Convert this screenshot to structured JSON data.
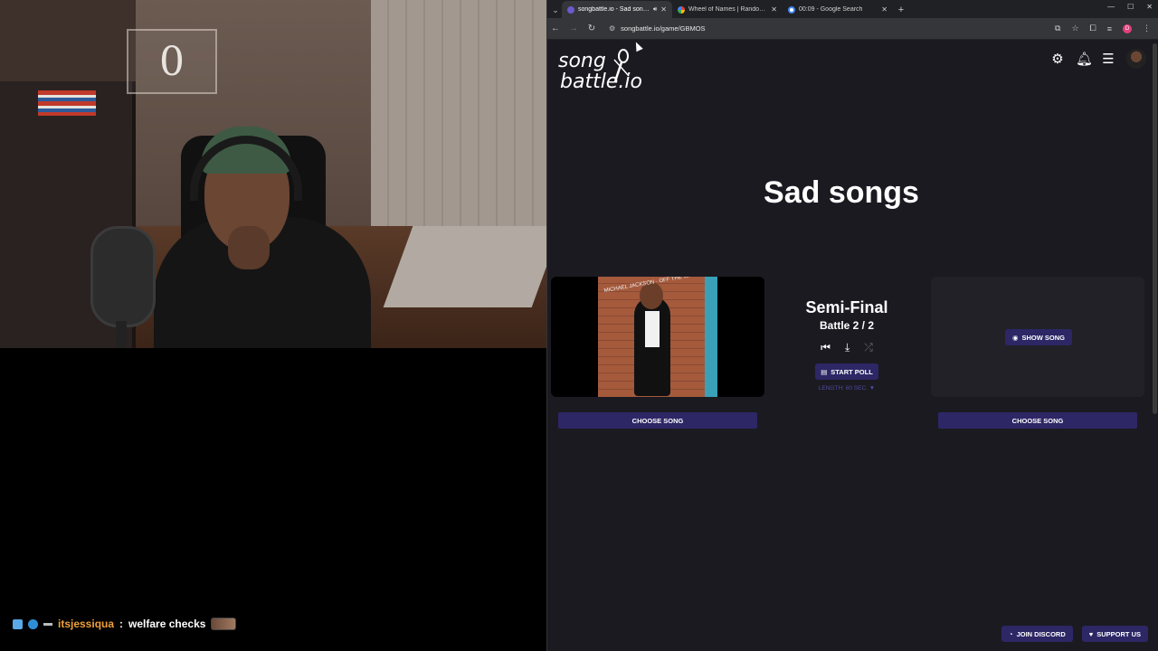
{
  "chat": {
    "username": "itsjessiqua",
    "separator": ":",
    "message": "welfare checks"
  },
  "browser": {
    "tabs": [
      {
        "title": "songbattle.io - Sad songs",
        "active": true
      },
      {
        "title": "Wheel of Names | Random na",
        "active": false
      },
      {
        "title": "00:09 - Google Search",
        "active": false
      }
    ],
    "url": "songbattle.io/game/GBMOS",
    "profile_initial": "D"
  },
  "page": {
    "logo_line1": "song",
    "logo_line2": "battle.io",
    "title": "Sad songs",
    "round_name": "Semi-Final",
    "battle_label": "Battle 2 / 2",
    "start_poll_label": "START POLL",
    "length_label": "LENGTH: 60 SEC. ▼",
    "show_song_label": "SHOW SONG",
    "choose_song_left": "CHOOSE SONG",
    "choose_song_right": "CHOOSE SONG",
    "album_text": "MICHAEL JACKSON · OFF THE WALL",
    "footer": {
      "discord_label": "JOIN DISCORD",
      "support_label": "SUPPORT US"
    }
  },
  "icons": {
    "settings": "gear-icon",
    "notifications": "bell-icon",
    "menu": "hamburger-icon",
    "eye": "eye-icon",
    "discord": "discord-icon",
    "support": "heart-icon"
  },
  "colors": {
    "page_bg": "#1b1a21",
    "button_bg": "#2d2766",
    "length_text": "#4e4aa0",
    "chat_username": "#f0a03a"
  }
}
